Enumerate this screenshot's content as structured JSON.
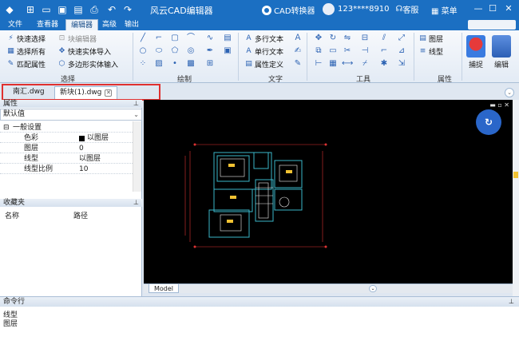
{
  "titlebar": {
    "title": "风云CAD编辑器",
    "convert_label": "CAD转换器",
    "user": "123****8910",
    "service_label": "客服",
    "menu_label": "菜单"
  },
  "ribbon_tabs": [
    {
      "label": "文件"
    },
    {
      "label": "查看器"
    },
    {
      "label": "编辑器"
    },
    {
      "label": "高级"
    },
    {
      "label": "输出"
    }
  ],
  "ribbon": {
    "select_group": {
      "label": "选择",
      "items": [
        "快速选择",
        "选择所有",
        "匹配属性",
        "块编辑器",
        "快速实体导入",
        "多边形实体输入"
      ]
    },
    "draw_group": {
      "label": "绘制"
    },
    "text_group": {
      "label": "文字",
      "items": [
        "多行文本",
        "单行文本",
        "属性定义"
      ]
    },
    "tools_group": {
      "label": "工具"
    },
    "props_group": {
      "label": "属性",
      "items": [
        "图层",
        "线型"
      ]
    },
    "capture_label": "捕捉",
    "edit_label": "编辑"
  },
  "doc_tabs": [
    {
      "label": "南汇.dwg"
    },
    {
      "label": "新块(1).dwg"
    }
  ],
  "properties": {
    "header": "属性",
    "dropdown_value": "默认值",
    "section": "一般设置",
    "rows": [
      {
        "key": "色彩",
        "value": "以图层"
      },
      {
        "key": "图层",
        "value": "0"
      },
      {
        "key": "线型",
        "value": "以图层"
      },
      {
        "key": "线型比例",
        "value": "10"
      }
    ]
  },
  "favorites": {
    "header": "收藏夹",
    "col_name": "名称",
    "col_path": "路径"
  },
  "canvas": {
    "fab_label": "↻"
  },
  "model_tab": "Model",
  "command": {
    "header": "命令行",
    "lines": [
      "线型",
      "图层"
    ]
  },
  "colors": {
    "titlebar": "#1b6fc2",
    "canvas_bg": "#000000",
    "highlight": "#e0302f",
    "fab": "#2a66c9"
  }
}
